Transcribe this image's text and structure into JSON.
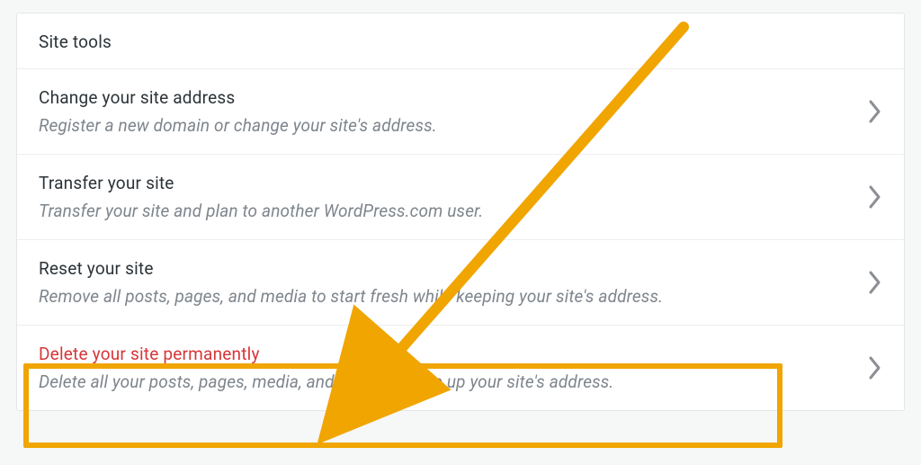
{
  "section": {
    "title": "Site tools"
  },
  "rows": [
    {
      "title": "Change your site address",
      "desc": "Register a new domain or change your site's address."
    },
    {
      "title": "Transfer your site",
      "desc": "Transfer your site and plan to another WordPress.com user."
    },
    {
      "title": "Reset your site",
      "desc": "Remove all posts, pages, and media to start fresh while keeping your site's address."
    },
    {
      "title": "Delete your site permanently",
      "desc": "Delete all your posts, pages, media, and data, and give up your site's address."
    }
  ],
  "annotation": {
    "color": "#f0a500"
  }
}
